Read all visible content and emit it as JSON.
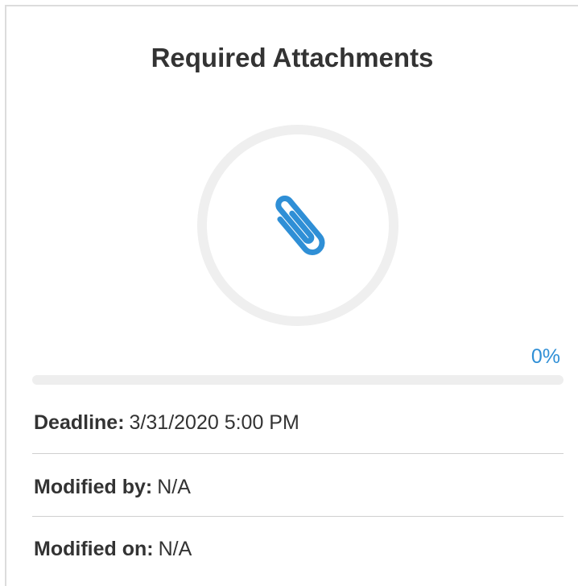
{
  "card": {
    "title": "Required Attachments",
    "icon": "paperclip-icon",
    "accent_color": "#2f8fd6",
    "progress": {
      "label": "0%",
      "value": 0
    },
    "details": {
      "deadline": {
        "label": "Deadline:",
        "value": "3/31/2020 5:00 PM"
      },
      "modified_by": {
        "label": "Modified by:",
        "value": "N/A"
      },
      "modified_on": {
        "label": "Modified on:",
        "value": "N/A"
      }
    }
  }
}
